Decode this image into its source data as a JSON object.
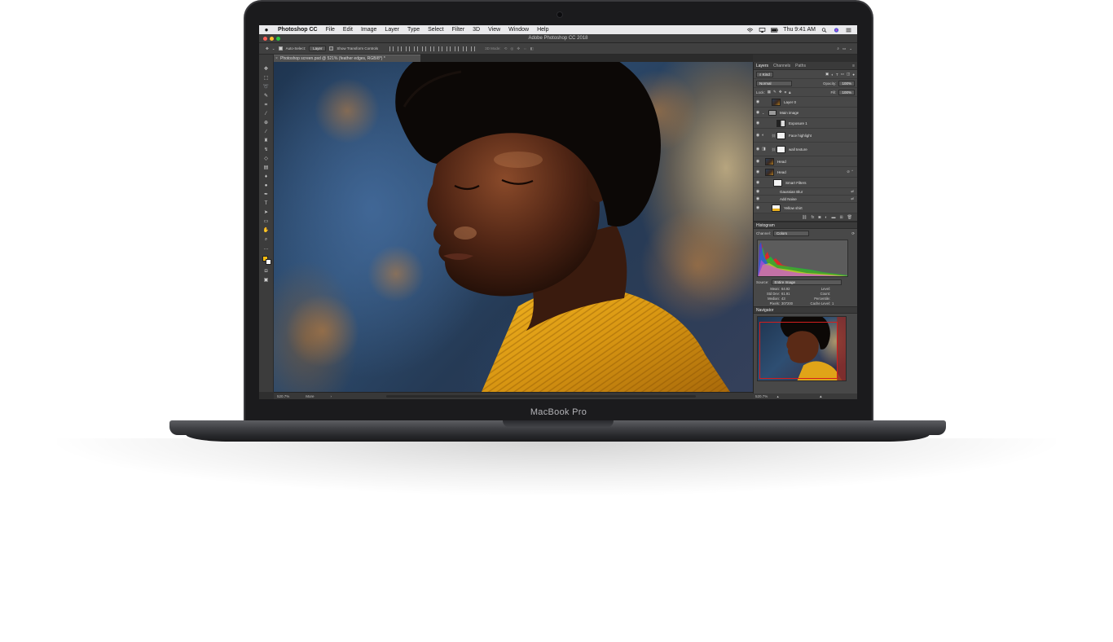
{
  "device": {
    "model_label": "MacBook Pro"
  },
  "menubar": {
    "items": [
      "Photoshop CC",
      "File",
      "Edit",
      "Image",
      "Layer",
      "Type",
      "Select",
      "Filter",
      "3D",
      "View",
      "Window",
      "Help"
    ],
    "clock": "Thu 9:41 AM"
  },
  "window": {
    "title": "Adobe Photoshop CC 2018"
  },
  "options_bar": {
    "auto_select_label": "Auto-Select:",
    "auto_select_value": "Layer",
    "transform_label": "Show Transform Controls",
    "mode_label": "3D Mode:"
  },
  "document": {
    "tab_title": "Photoshop screen.psd @ 521% (feather edges, RGB/8*) *"
  },
  "status": {
    "zoom": "520.7%",
    "info": "More"
  },
  "layers_panel": {
    "tabs": [
      "Layers",
      "Channels",
      "Paths"
    ],
    "filter_kind": "Kind",
    "blend_mode": "Normal",
    "opacity_label": "Opacity:",
    "opacity_value": "100%",
    "lock_label": "Lock:",
    "fill_label": "Fill:",
    "fill_value": "100%",
    "layers": [
      {
        "name": "Layer 0",
        "thumb": "photo"
      },
      {
        "name": "Main image",
        "thumb": "folder"
      },
      {
        "name": "Exposure 1",
        "thumb": "adj"
      },
      {
        "name": "Face highlight",
        "thumb": "white"
      },
      {
        "name": "wall texture",
        "thumb": "white"
      },
      {
        "name": "Head",
        "thumb": "photo"
      },
      {
        "name": "Head",
        "thumb": "photo"
      },
      {
        "name": "Smart Filters",
        "thumb": "white"
      },
      {
        "name": "Gaussian Blur",
        "thumb": ""
      },
      {
        "name": "Add Noise",
        "thumb": ""
      },
      {
        "name": "Yellow shirt",
        "thumb": "yellow"
      }
    ]
  },
  "histogram_panel": {
    "title": "Histogram",
    "channel_label": "Channel:",
    "channel_value": "Colors",
    "source_label": "Source:",
    "source_value": "Entire Image",
    "stats": [
      {
        "k": "Mean:",
        "v": "64.92",
        "k2": "Level:",
        "v2": ""
      },
      {
        "k": "Std Dev:",
        "v": "61.91",
        "k2": "Count:",
        "v2": ""
      },
      {
        "k": "Median:",
        "v": "43",
        "k2": "Percentile:",
        "v2": ""
      },
      {
        "k": "Pixels:",
        "v": "307200",
        "k2": "Cache Level:",
        "v2": "1"
      }
    ]
  },
  "navigator_panel": {
    "title": "Navigator",
    "zoom": "520.7%"
  }
}
